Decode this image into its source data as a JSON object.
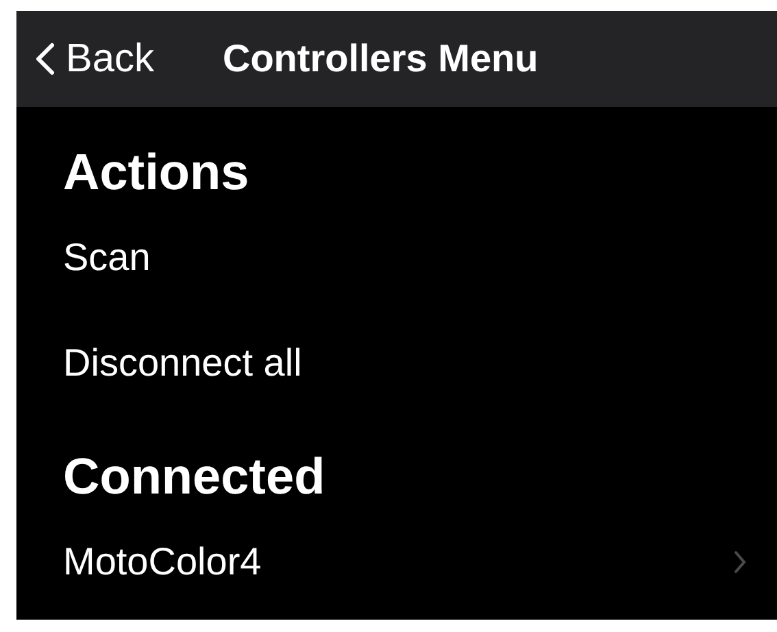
{
  "nav_bar": {
    "back": "Back",
    "title": "Controllers Menu"
  },
  "sections": [
    {
      "title": "Actions",
      "items": [
        {
          "label": "Scan",
          "kind": "action"
        },
        {
          "label": "Disconnect all",
          "kind": "action"
        }
      ]
    },
    {
      "title": "Connected",
      "items": [
        {
          "label": "MotoColor4",
          "kind": "link"
        }
      ]
    }
  ]
}
